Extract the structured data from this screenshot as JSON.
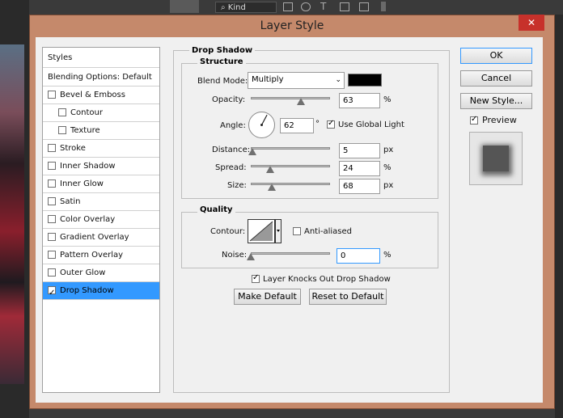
{
  "background": {
    "kind_label": "Kind"
  },
  "dialog": {
    "title": "Layer Style",
    "close": "✕"
  },
  "styles_list": {
    "header": "Styles",
    "blending": "Blending Options: Default",
    "items": [
      {
        "label": "Bevel & Emboss",
        "checked": false
      },
      {
        "label": "Contour",
        "checked": false
      },
      {
        "label": "Texture",
        "checked": false
      },
      {
        "label": "Stroke",
        "checked": false
      },
      {
        "label": "Inner Shadow",
        "checked": false
      },
      {
        "label": "Inner Glow",
        "checked": false
      },
      {
        "label": "Satin",
        "checked": false
      },
      {
        "label": "Color Overlay",
        "checked": false
      },
      {
        "label": "Gradient Overlay",
        "checked": false
      },
      {
        "label": "Pattern Overlay",
        "checked": false
      },
      {
        "label": "Outer Glow",
        "checked": false
      },
      {
        "label": "Drop Shadow",
        "checked": true,
        "selected": true
      }
    ]
  },
  "drop_shadow": {
    "title": "Drop Shadow",
    "structure": {
      "title": "Structure",
      "blend_mode_label": "Blend Mode:",
      "blend_mode_value": "Multiply",
      "shadow_color": "#000000",
      "opacity_label": "Opacity:",
      "opacity_value": "63",
      "opacity_unit": "%",
      "angle_label": "Angle:",
      "angle_value": "62",
      "angle_unit": "°",
      "use_global_light": "Use Global Light",
      "distance_label": "Distance:",
      "distance_value": "5",
      "distance_unit": "px",
      "spread_label": "Spread:",
      "spread_value": "24",
      "spread_unit": "%",
      "size_label": "Size:",
      "size_value": "68",
      "size_unit": "px"
    },
    "quality": {
      "title": "Quality",
      "contour_label": "Contour:",
      "anti_aliased": "Anti-aliased",
      "noise_label": "Noise:",
      "noise_value": "0",
      "noise_unit": "%"
    },
    "knockout": "Layer Knocks Out Drop Shadow",
    "make_default": "Make Default",
    "reset_default": "Reset to Default"
  },
  "buttons": {
    "ok": "OK",
    "cancel": "Cancel",
    "new_style": "New Style...",
    "preview": "Preview"
  },
  "sliders": {
    "opacity": 0.63,
    "distance": 0.02,
    "spread": 0.24,
    "size": 0.27,
    "noise": 0.0
  }
}
